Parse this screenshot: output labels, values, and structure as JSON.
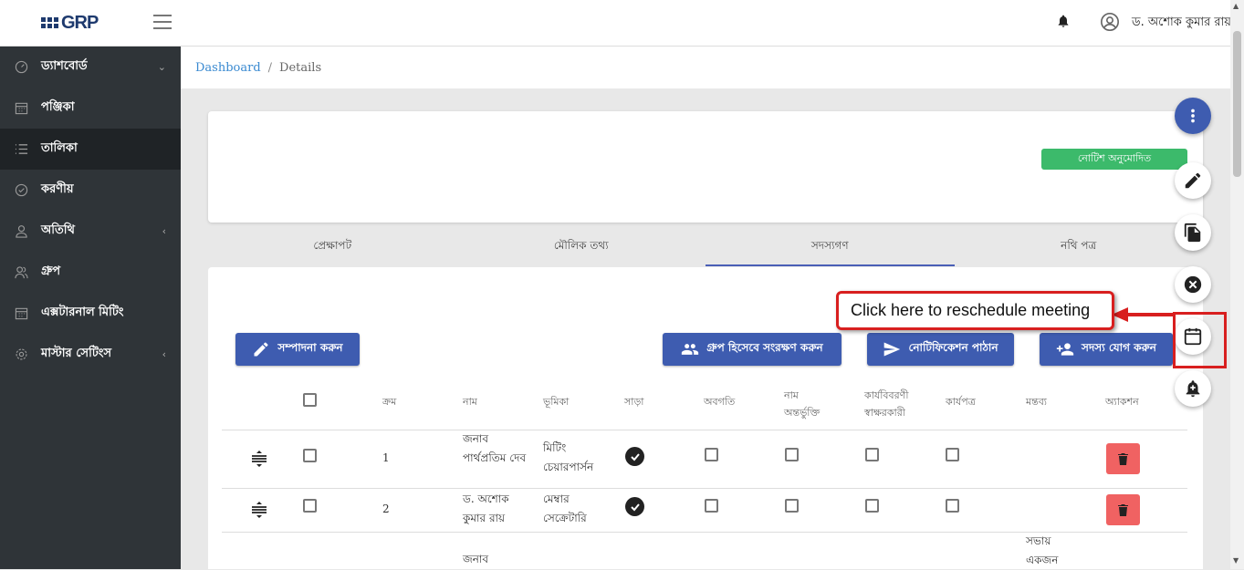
{
  "header": {
    "logo_text": "GRP",
    "user_name": "ড. অশোক কুমার রায়"
  },
  "sidebar": {
    "items": [
      {
        "label": "ড্যাশবোর্ড",
        "icon": "gauge-icon",
        "chevron": "⌄"
      },
      {
        "label": "পঞ্জিকা",
        "icon": "calendar-icon",
        "chevron": ""
      },
      {
        "label": "তালিকা",
        "icon": "list-icon",
        "chevron": ""
      },
      {
        "label": "করণীয়",
        "icon": "check-circle-icon",
        "chevron": ""
      },
      {
        "label": "অতিথি",
        "icon": "user-icon",
        "chevron": "‹"
      },
      {
        "label": "গ্রুপ",
        "icon": "group-icon",
        "chevron": ""
      },
      {
        "label": "এক্সটারনাল মিটিং",
        "icon": "calendar-icon",
        "chevron": ""
      },
      {
        "label": "মাস্টার সেটিংস",
        "icon": "gear-icon",
        "chevron": "‹"
      }
    ]
  },
  "breadcrumb": {
    "home": "Dashboard",
    "separator": "/",
    "current": "Details"
  },
  "info": {
    "status_badge": "নোটিশ অনুমোদিত"
  },
  "tabs": [
    "প্রেক্ষাপট",
    "মৌলিক তথ্য",
    "সদস্যগণ",
    "নথি পত্র"
  ],
  "active_tab": "সদস্যগণ",
  "actions": {
    "edit": "সম্পাদনা করুন",
    "save_group": "গ্রুপ হিসেবে সংরক্ষণ করুন",
    "send_notification": "নোটিফিকেশন পাঠান",
    "add_member": "সদস্য যোগ করুন"
  },
  "table": {
    "headers": {
      "serial": "ক্রম",
      "name": "নাম",
      "role": "ভূমিকা",
      "response": "সাড়া",
      "progress": "অবগতি",
      "name_include": "নাম অন্তর্ভুক্তি",
      "minutes_signer": "কার্যবিবরণী স্বাক্ষরকারী",
      "agenda": "কার্যপত্র",
      "comment": "মন্তব্য",
      "action": "অ্যাকশন"
    },
    "rows": [
      {
        "serial": "1",
        "name": "জনাব পার্থপ্রতিম দেব",
        "role": "মিটিং চেয়ারপার্সন",
        "responded": true,
        "comment": ""
      },
      {
        "serial": "2",
        "name": "ড. অশোক কুমার রায়",
        "role": "মেম্বার সেক্রেটারি",
        "responded": true,
        "comment": ""
      },
      {
        "serial": "",
        "name": "জনাব",
        "role": "",
        "responded": false,
        "comment": "সভায় একজন"
      }
    ]
  },
  "callout": {
    "text": "Click here to reschedule meeting"
  },
  "colors": {
    "primary": "#3e5cb0",
    "sidebar": "#2f3438",
    "success": "#3cba6b",
    "danger": "#f06262",
    "annotation": "#d81f1f"
  }
}
